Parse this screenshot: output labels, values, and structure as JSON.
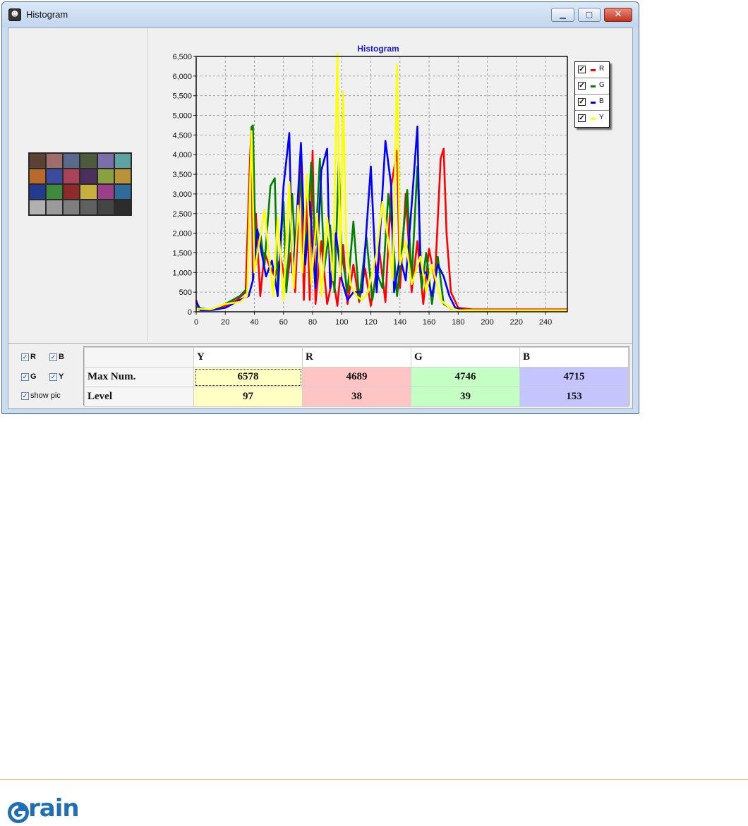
{
  "window": {
    "title": "Histogram",
    "app_icon": "app-icon",
    "minimize_icon": "minimize-icon",
    "maximize_icon": "maximize-icon",
    "close_icon": "close-icon"
  },
  "thumbnail": {
    "colors": [
      "#5c4033",
      "#a06d6d",
      "#5b6a8c",
      "#4b5b3c",
      "#7a6fa8",
      "#5fa3a0",
      "#b86a2e",
      "#3c4b9c",
      "#a8435a",
      "#4c2f5c",
      "#8aa043",
      "#b89338",
      "#243a8c",
      "#3f8a3f",
      "#8e2a2a",
      "#c8b040",
      "#9a3f88",
      "#2f6c9c",
      "#b0b0b0",
      "#9a9a9a",
      "#7e7e7e",
      "#606060",
      "#454545",
      "#2c2c2c"
    ]
  },
  "chart_data": {
    "type": "line",
    "title": "Histogram",
    "xlim": [
      0,
      255
    ],
    "ylim": [
      0,
      6500
    ],
    "xticks": [
      0,
      20,
      40,
      60,
      80,
      100,
      120,
      140,
      160,
      180,
      200,
      220,
      240
    ],
    "yticks": [
      0,
      500,
      1000,
      1500,
      2000,
      2500,
      3000,
      3500,
      4000,
      4500,
      5000,
      5500,
      6000,
      6500
    ],
    "ytick_labels": [
      "0",
      "500",
      "1,000",
      "1,500",
      "2,000",
      "2,500",
      "3,000",
      "3,500",
      "4,000",
      "4,500",
      "5,000",
      "5,500",
      "6,000",
      "6,500"
    ],
    "grid": true,
    "legend": "top-right",
    "series": [
      {
        "name": "R",
        "color": "#ff0000",
        "points": [
          [
            0,
            300
          ],
          [
            2,
            60
          ],
          [
            10,
            60
          ],
          [
            20,
            150
          ],
          [
            28,
            300
          ],
          [
            34,
            500
          ],
          [
            37,
            3900
          ],
          [
            38,
            4689
          ],
          [
            39,
            800
          ],
          [
            41,
            2500
          ],
          [
            44,
            400
          ],
          [
            47,
            1500
          ],
          [
            50,
            1200
          ],
          [
            54,
            900
          ],
          [
            58,
            1400
          ],
          [
            62,
            600
          ],
          [
            65,
            1500
          ],
          [
            68,
            500
          ],
          [
            72,
            4000
          ],
          [
            74,
            300
          ],
          [
            76,
            3000
          ],
          [
            78,
            300
          ],
          [
            80,
            4100
          ],
          [
            82,
            200
          ],
          [
            86,
            1800
          ],
          [
            90,
            200
          ],
          [
            94,
            900
          ],
          [
            97,
            150
          ],
          [
            101,
            1700
          ],
          [
            104,
            200
          ],
          [
            108,
            1200
          ],
          [
            112,
            250
          ],
          [
            116,
            1100
          ],
          [
            120,
            150
          ],
          [
            126,
            1500
          ],
          [
            130,
            250
          ],
          [
            134,
            3200
          ],
          [
            138,
            4100
          ],
          [
            140,
            600
          ],
          [
            144,
            3000
          ],
          [
            148,
            500
          ],
          [
            152,
            1800
          ],
          [
            156,
            200
          ],
          [
            160,
            1600
          ],
          [
            164,
            800
          ],
          [
            168,
            3900
          ],
          [
            170,
            4150
          ],
          [
            172,
            2000
          ],
          [
            175,
            500
          ],
          [
            180,
            100
          ],
          [
            190,
            60
          ],
          [
            255,
            60
          ]
        ]
      },
      {
        "name": "G",
        "color": "#008000",
        "points": [
          [
            0,
            120
          ],
          [
            10,
            40
          ],
          [
            20,
            200
          ],
          [
            30,
            400
          ],
          [
            35,
            600
          ],
          [
            38,
            4700
          ],
          [
            39,
            4746
          ],
          [
            41,
            1200
          ],
          [
            44,
            2000
          ],
          [
            47,
            1200
          ],
          [
            51,
            3200
          ],
          [
            54,
            3400
          ],
          [
            56,
            600
          ],
          [
            60,
            2800
          ],
          [
            62,
            500
          ],
          [
            66,
            3000
          ],
          [
            68,
            1500
          ],
          [
            71,
            3500
          ],
          [
            73,
            2600
          ],
          [
            76,
            1600
          ],
          [
            79,
            3800
          ],
          [
            82,
            1700
          ],
          [
            85,
            3900
          ],
          [
            88,
            1100
          ],
          [
            92,
            2200
          ],
          [
            95,
            500
          ],
          [
            98,
            3800
          ],
          [
            100,
            1500
          ],
          [
            104,
            500
          ],
          [
            108,
            2300
          ],
          [
            112,
            300
          ],
          [
            117,
            1900
          ],
          [
            121,
            300
          ],
          [
            124,
            1000
          ],
          [
            128,
            600
          ],
          [
            132,
            3000
          ],
          [
            135,
            2000
          ],
          [
            138,
            400
          ],
          [
            142,
            1900
          ],
          [
            145,
            3100
          ],
          [
            148,
            800
          ],
          [
            152,
            3700
          ],
          [
            155,
            600
          ],
          [
            158,
            1500
          ],
          [
            162,
            200
          ],
          [
            166,
            1400
          ],
          [
            170,
            200
          ],
          [
            175,
            80
          ],
          [
            180,
            60
          ],
          [
            190,
            40
          ],
          [
            255,
            40
          ]
        ]
      },
      {
        "name": "B",
        "color": "#0000ff",
        "points": [
          [
            0,
            260
          ],
          [
            3,
            40
          ],
          [
            10,
            40
          ],
          [
            20,
            100
          ],
          [
            30,
            300
          ],
          [
            36,
            400
          ],
          [
            39,
            800
          ],
          [
            42,
            2100
          ],
          [
            45,
            1500
          ],
          [
            48,
            900
          ],
          [
            52,
            1300
          ],
          [
            56,
            400
          ],
          [
            60,
            3200
          ],
          [
            64,
            4550
          ],
          [
            66,
            1000
          ],
          [
            68,
            1700
          ],
          [
            72,
            4300
          ],
          [
            75,
            1200
          ],
          [
            78,
            2800
          ],
          [
            82,
            600
          ],
          [
            86,
            3600
          ],
          [
            90,
            4150
          ],
          [
            92,
            600
          ],
          [
            96,
            2000
          ],
          [
            100,
            800
          ],
          [
            104,
            300
          ],
          [
            108,
            500
          ],
          [
            114,
            500
          ],
          [
            120,
            3700
          ],
          [
            124,
            500
          ],
          [
            130,
            4350
          ],
          [
            134,
            3200
          ],
          [
            136,
            500
          ],
          [
            140,
            1400
          ],
          [
            144,
            800
          ],
          [
            148,
            2700
          ],
          [
            152,
            4715
          ],
          [
            154,
            1000
          ],
          [
            158,
            1000
          ],
          [
            162,
            400
          ],
          [
            166,
            1200
          ],
          [
            170,
            900
          ],
          [
            174,
            400
          ],
          [
            178,
            100
          ],
          [
            185,
            40
          ],
          [
            255,
            40
          ]
        ]
      },
      {
        "name": "Y",
        "color": "#ffff00",
        "points": [
          [
            0,
            80
          ],
          [
            10,
            60
          ],
          [
            20,
            200
          ],
          [
            30,
            250
          ],
          [
            35,
            400
          ],
          [
            38,
            4600
          ],
          [
            40,
            1000
          ],
          [
            43,
            1700
          ],
          [
            47,
            2600
          ],
          [
            50,
            1400
          ],
          [
            53,
            400
          ],
          [
            56,
            2400
          ],
          [
            60,
            300
          ],
          [
            64,
            3300
          ],
          [
            67,
            600
          ],
          [
            70,
            2700
          ],
          [
            73,
            1000
          ],
          [
            76,
            3500
          ],
          [
            79,
            700
          ],
          [
            83,
            2500
          ],
          [
            86,
            400
          ],
          [
            90,
            2400
          ],
          [
            94,
            800
          ],
          [
            97,
            6578
          ],
          [
            99,
            900
          ],
          [
            101,
            5600
          ],
          [
            103,
            1800
          ],
          [
            106,
            700
          ],
          [
            110,
            400
          ],
          [
            114,
            300
          ],
          [
            118,
            500
          ],
          [
            124,
            1500
          ],
          [
            128,
            2800
          ],
          [
            132,
            1800
          ],
          [
            135,
            800
          ],
          [
            138,
            6300
          ],
          [
            140,
            1200
          ],
          [
            144,
            1800
          ],
          [
            148,
            700
          ],
          [
            154,
            1400
          ],
          [
            158,
            500
          ],
          [
            162,
            1200
          ],
          [
            168,
            300
          ],
          [
            174,
            100
          ],
          [
            180,
            40
          ],
          [
            255,
            40
          ]
        ]
      }
    ]
  },
  "legend_items": [
    {
      "label": "R",
      "color": "#ff0000"
    },
    {
      "label": "G",
      "color": "#008000"
    },
    {
      "label": "B",
      "color": "#0000ff"
    },
    {
      "label": "Y",
      "color": "#ffff00"
    }
  ],
  "checkboxes": {
    "r": "R",
    "b": "B",
    "g": "G",
    "y": "Y",
    "show_pic": "show pic"
  },
  "table": {
    "headers": [
      "",
      "Y",
      "R",
      "G",
      "B"
    ],
    "rows": [
      {
        "label": "Max Num.",
        "values": [
          "6578",
          "4689",
          "4746",
          "4715"
        ]
      },
      {
        "label": "Level",
        "values": [
          "97",
          "38",
          "39",
          "153"
        ]
      }
    ]
  },
  "footer": {
    "logo_text": "rain"
  }
}
